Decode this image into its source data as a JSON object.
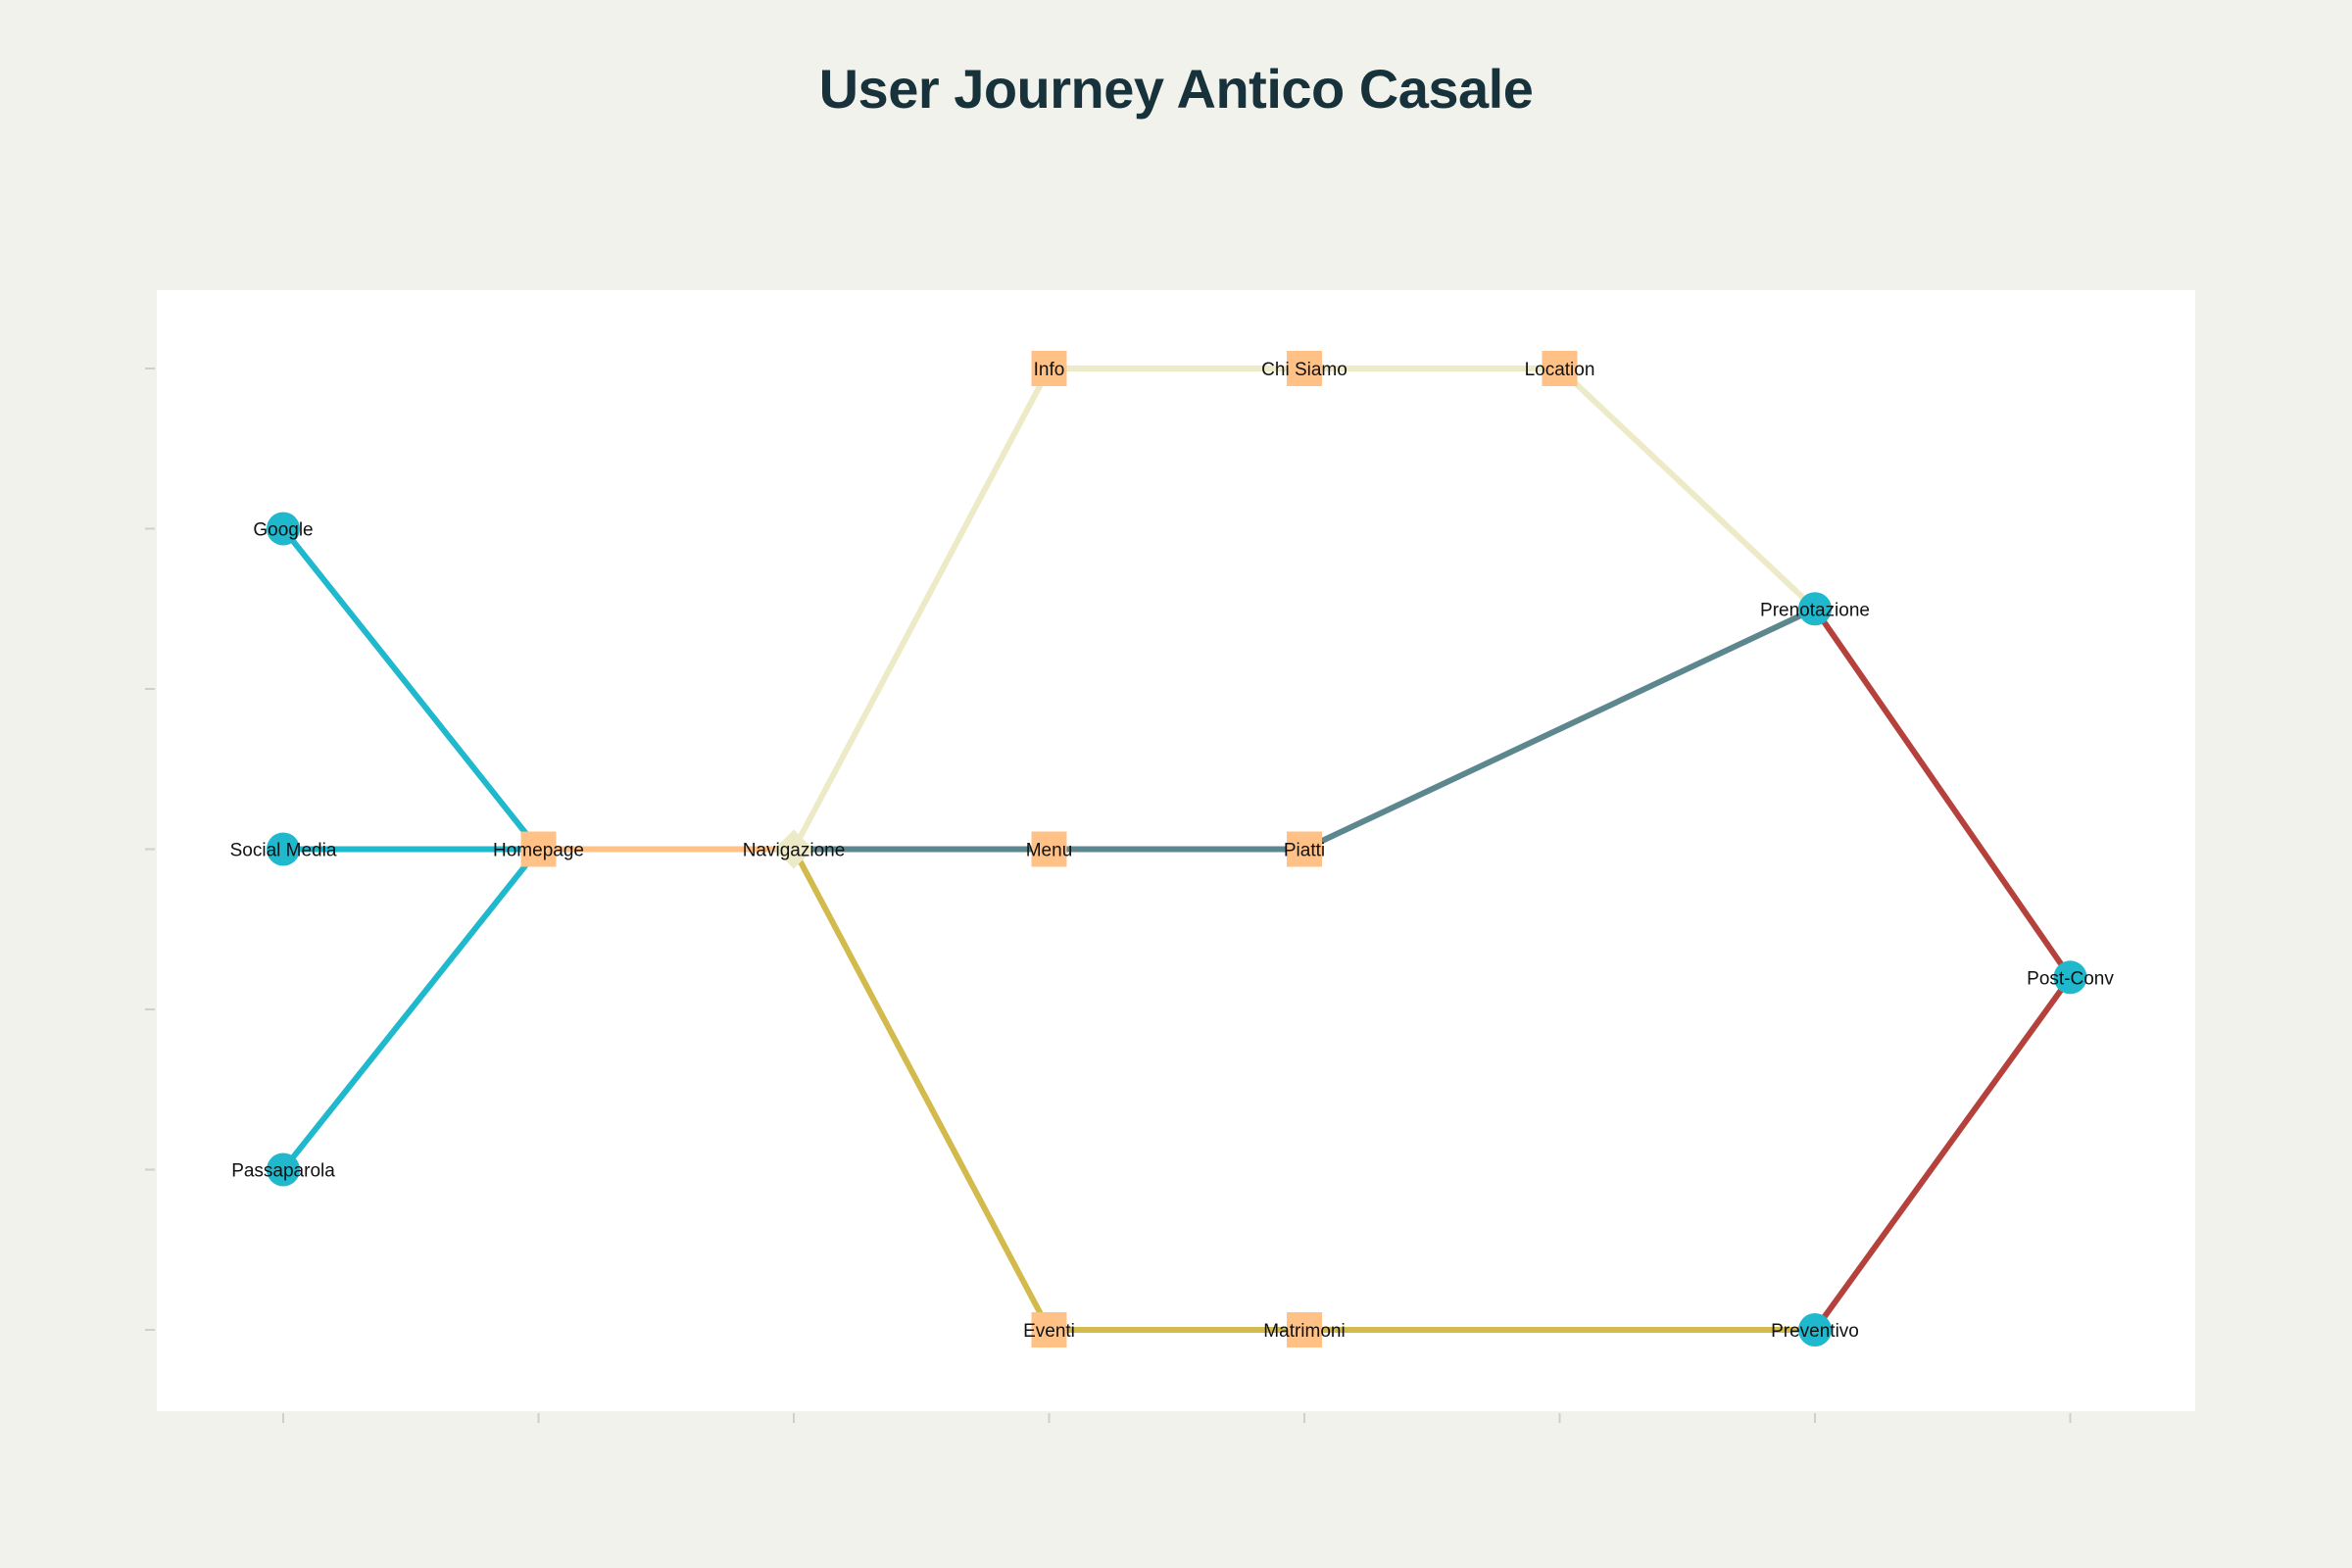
{
  "title": "User Journey Antico Casale",
  "colors": {
    "background": "#f2f2ed",
    "plot_background": "#ffffff",
    "title": "#17323a",
    "node_circle": "#1fb8cd",
    "node_square": "#ffc185",
    "node_diamond": "#eceac7",
    "edge_cyan": "#1fb8cd",
    "edge_orange": "#ffc185",
    "edge_beige": "#eceac7",
    "edge_slate": "#5d878f",
    "edge_gold": "#d2ba4c",
    "edge_red": "#b4413c"
  },
  "nodes": [
    {
      "id": "google",
      "label": "Google",
      "shape": "circle",
      "stage": 0,
      "level": 6
    },
    {
      "id": "social",
      "label": "Social Media",
      "shape": "circle",
      "stage": 0,
      "level": 4
    },
    {
      "id": "passaparola",
      "label": "Passaparola",
      "shape": "circle",
      "stage": 0,
      "level": 2
    },
    {
      "id": "homepage",
      "label": "Homepage",
      "shape": "square",
      "stage": 1,
      "level": 4
    },
    {
      "id": "navigazione",
      "label": "Navigazione",
      "shape": "diamond",
      "stage": 2,
      "level": 4
    },
    {
      "id": "info",
      "label": "Info",
      "shape": "square",
      "stage": 3,
      "level": 7
    },
    {
      "id": "menu",
      "label": "Menu",
      "shape": "square",
      "stage": 3,
      "level": 4
    },
    {
      "id": "eventi",
      "label": "Eventi",
      "shape": "square",
      "stage": 3,
      "level": 1
    },
    {
      "id": "chisiamo",
      "label": "Chi Siamo",
      "shape": "square",
      "stage": 4,
      "level": 7
    },
    {
      "id": "piatti",
      "label": "Piatti",
      "shape": "square",
      "stage": 4,
      "level": 4
    },
    {
      "id": "matrimoni",
      "label": "Matrimoni",
      "shape": "square",
      "stage": 4,
      "level": 1
    },
    {
      "id": "location",
      "label": "Location",
      "shape": "square",
      "stage": 5,
      "level": 7
    },
    {
      "id": "prenotazione",
      "label": "Prenotazione",
      "shape": "circle",
      "stage": 6,
      "level": 5.5
    },
    {
      "id": "preventivo",
      "label": "Preventivo",
      "shape": "circle",
      "stage": 6,
      "level": 1
    },
    {
      "id": "postconv",
      "label": "Post-Conv",
      "shape": "circle",
      "stage": 7,
      "level": 3.2
    }
  ],
  "edges": [
    {
      "from": "google",
      "to": "homepage",
      "color": "edge_cyan"
    },
    {
      "from": "social",
      "to": "homepage",
      "color": "edge_cyan"
    },
    {
      "from": "passaparola",
      "to": "homepage",
      "color": "edge_cyan"
    },
    {
      "from": "homepage",
      "to": "navigazione",
      "color": "edge_orange"
    },
    {
      "from": "navigazione",
      "to": "info",
      "color": "edge_beige"
    },
    {
      "from": "info",
      "to": "chisiamo",
      "color": "edge_beige"
    },
    {
      "from": "chisiamo",
      "to": "location",
      "color": "edge_beige"
    },
    {
      "from": "location",
      "to": "prenotazione",
      "color": "edge_beige"
    },
    {
      "from": "navigazione",
      "to": "menu",
      "color": "edge_slate"
    },
    {
      "from": "menu",
      "to": "piatti",
      "color": "edge_slate"
    },
    {
      "from": "piatti",
      "to": "prenotazione",
      "color": "edge_slate"
    },
    {
      "from": "navigazione",
      "to": "eventi",
      "color": "edge_gold"
    },
    {
      "from": "eventi",
      "to": "matrimoni",
      "color": "edge_gold"
    },
    {
      "from": "matrimoni",
      "to": "preventivo",
      "color": "edge_gold"
    },
    {
      "from": "prenotazione",
      "to": "postconv",
      "color": "edge_red"
    },
    {
      "from": "preventivo",
      "to": "postconv",
      "color": "edge_red"
    }
  ],
  "axes": {
    "x_ticks": 8,
    "y_ticks": 7,
    "tick_labels_shown": false
  }
}
